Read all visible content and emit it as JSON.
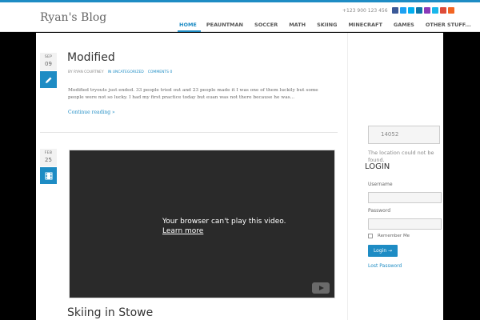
{
  "site": {
    "title": "Ryan's Blog",
    "phone": "+123 900 123 456"
  },
  "socials": [
    {
      "name": "facebook-icon",
      "color": "#3b5998"
    },
    {
      "name": "twitter-icon",
      "color": "#1da1f2"
    },
    {
      "name": "skype-icon",
      "color": "#00aff0"
    },
    {
      "name": "linkedin-icon",
      "color": "#0e76a8"
    },
    {
      "name": "instagram-icon",
      "color": "#8a3ab9"
    },
    {
      "name": "vimeo-icon",
      "color": "#1ab7ea"
    },
    {
      "name": "googleplus-icon",
      "color": "#dd4b39"
    },
    {
      "name": "rss-icon",
      "color": "#f26522"
    }
  ],
  "nav": [
    "HOME",
    "PEAUNTMAN",
    "SOCCER",
    "MATH",
    "SKIING",
    "MINECRAFT",
    "GAMES",
    "OTHER STUFF..."
  ],
  "post1": {
    "month": "SEP",
    "day": "09",
    "title": "Modified",
    "by": "BY RYAN COURTNEY",
    "category": "IN UNCATEGORIZED",
    "comments": "COMMENTS 0",
    "excerpt": "Modified tryouts just ended. 33 people tried out and 23 people made it I was one of them luckily but some people were not so lucky. I had my first practice today but euan was not there because he was...",
    "read_more": "Continue reading »"
  },
  "post2": {
    "month": "FEB",
    "day": "25",
    "video_message": "Your browser can't play this video.",
    "video_link": "Learn more",
    "title": "Skiing in Stowe"
  },
  "sidebar": {
    "weather_value": "14052",
    "weather_error": "The location could not be found.",
    "login_heading": "LOGIN",
    "username_label": "Username",
    "password_label": "Password",
    "remember_label": "Remember Me",
    "login_button": "Login →",
    "lost_password": "Lost Password"
  }
}
